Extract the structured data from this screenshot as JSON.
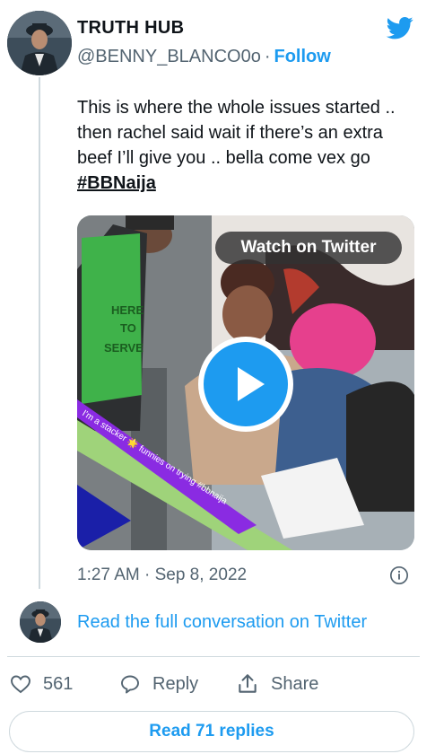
{
  "author": {
    "name": "TRUTH HUB",
    "handle": "@BENNY_BLANCO0o",
    "separator": "·",
    "follow_label": "Follow"
  },
  "tweet": {
    "text": "This is where the whole issues started .. then rachel said wait if there’s an extra beef I’ll give you .. bella come vex go",
    "hashtag": "#BBNaija",
    "timestamp": "1:27 AM · Sep 8, 2022"
  },
  "media": {
    "watch_label": "Watch on Twitter",
    "apron_text": [
      "HERE",
      "TO",
      "SERVE"
    ],
    "overlay_text": "I'm a stacker 🌟 funnies on trying #bbnaija",
    "kind": "video"
  },
  "conversation": {
    "read_full_label": "Read the full conversation on Twitter"
  },
  "actions": {
    "like_count": "561",
    "reply_label": "Reply",
    "share_label": "Share"
  },
  "footer": {
    "read_replies_label": "Read 71 replies"
  },
  "colors": {
    "accent": "#1d9bf0",
    "secondary_text": "#536471",
    "border": "#cfd9de"
  },
  "icons": {
    "brand": "twitter-bird-icon",
    "like": "heart-icon",
    "reply": "speech-bubble-icon",
    "share": "share-upload-icon",
    "info": "info-icon",
    "play": "play-icon"
  }
}
